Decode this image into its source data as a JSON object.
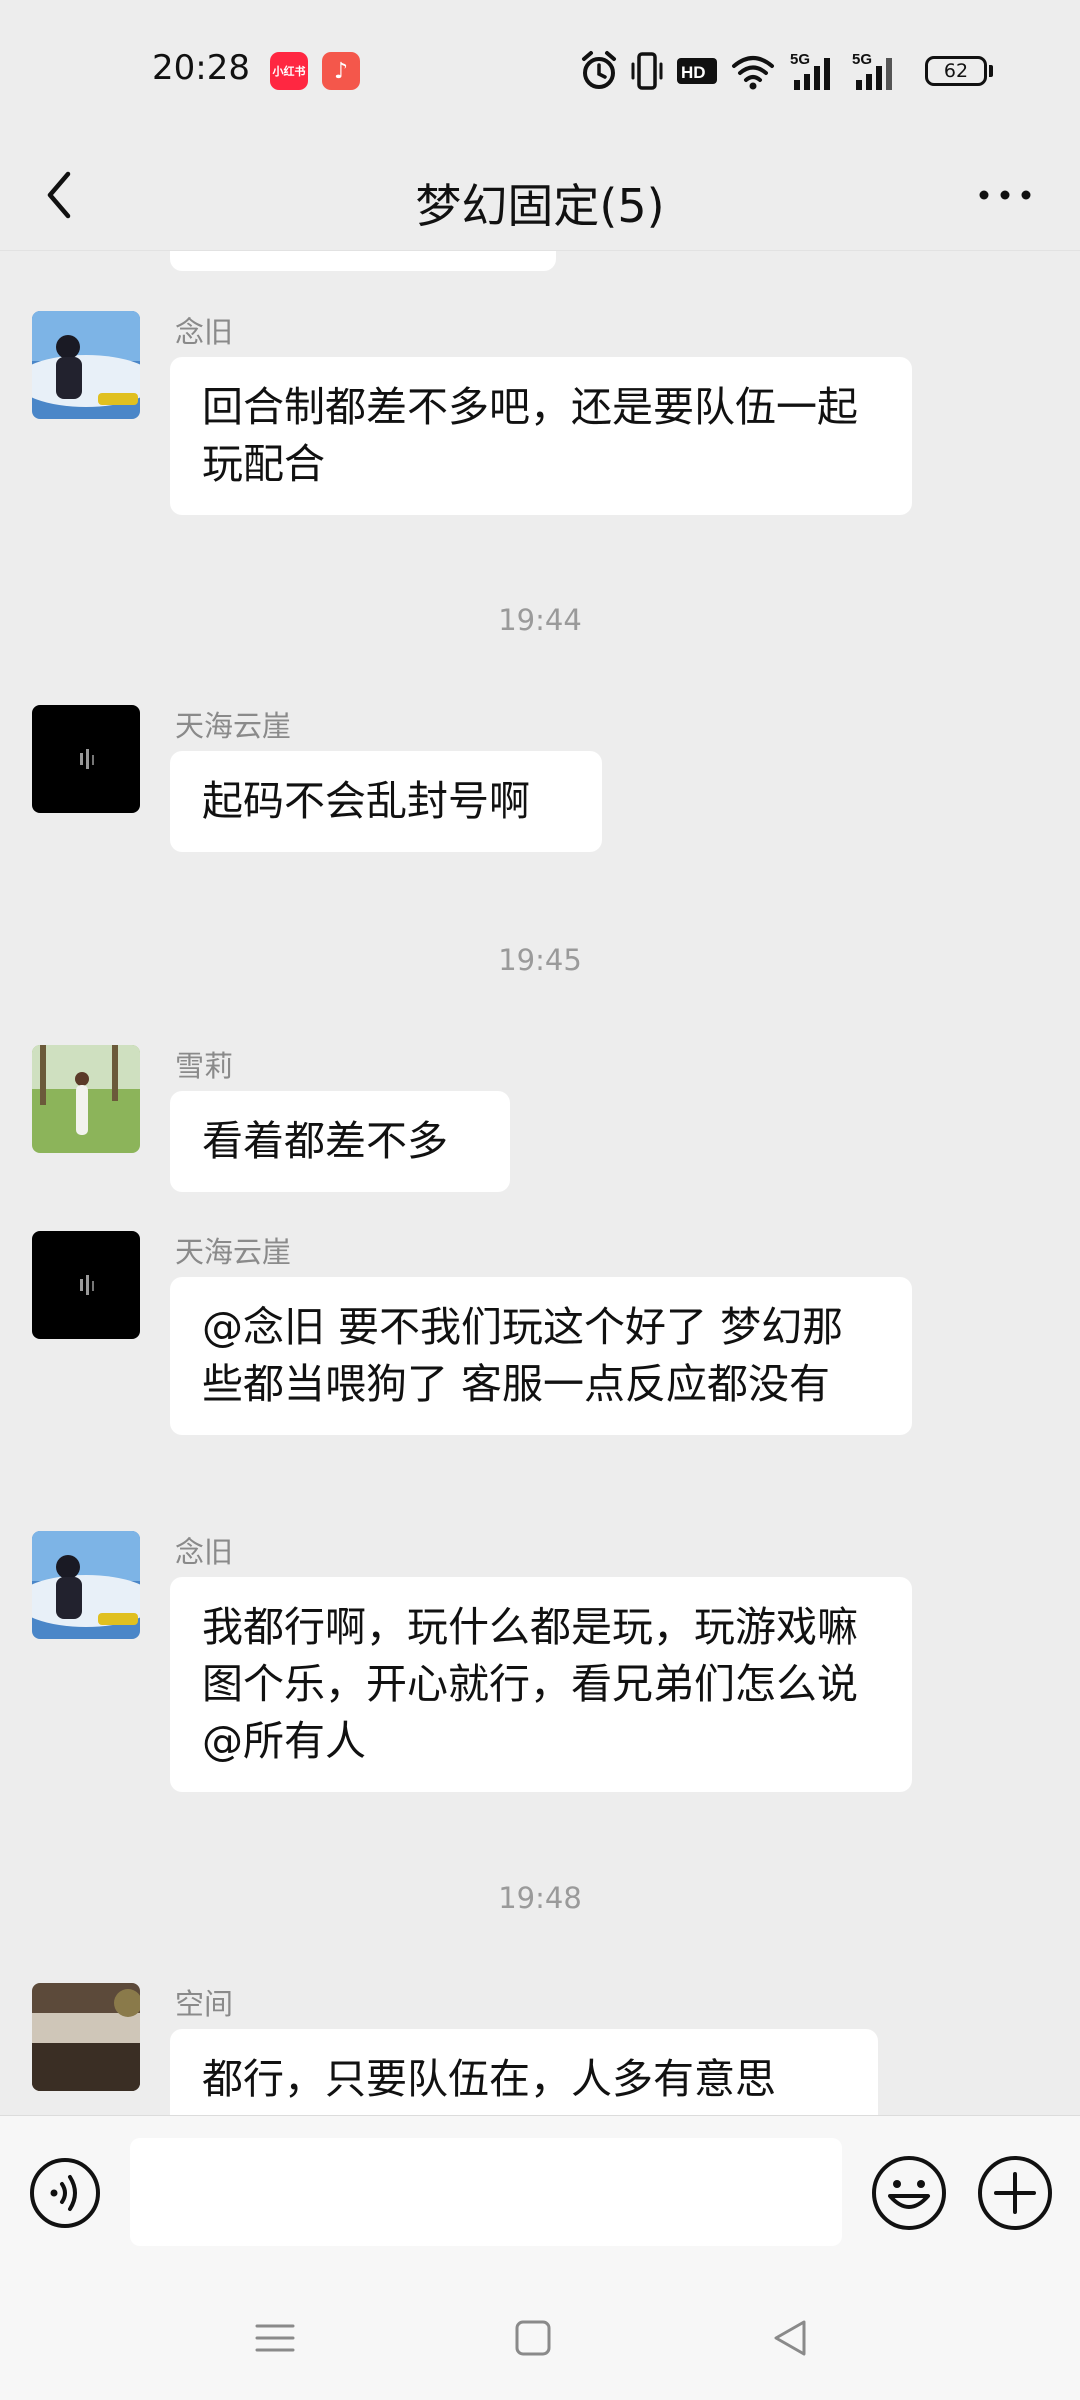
{
  "status_bar": {
    "time": "20:28",
    "app_badges": [
      {
        "name": "xiaohongshu-icon",
        "label": "小红书",
        "color": "#ff2741"
      },
      {
        "name": "music-app-icon",
        "label": "♪",
        "color": "#f4574b"
      }
    ],
    "icons": [
      "alarm-icon",
      "vibrate-icon",
      "hd-icon",
      "wifi-icon",
      "signal-5g-icon",
      "signal-5g-icon"
    ],
    "signal_label": "5G",
    "hd_label": "HD",
    "battery": "62"
  },
  "header": {
    "title": "梦幻固定(5)",
    "back_icon": "chevron-left-icon",
    "more_icon": "more-dots-icon"
  },
  "messages": [
    {
      "type": "text",
      "sender": "念旧",
      "text": "回合制都差不多吧，还是要队伍一起玩配合",
      "avatar": "nianjiu"
    },
    {
      "type": "time",
      "text": "19:44"
    },
    {
      "type": "text",
      "sender": "天海云崖",
      "text": "起码不会乱封号啊",
      "avatar": "tianhai"
    },
    {
      "type": "time",
      "text": "19:45"
    },
    {
      "type": "text",
      "sender": "雪莉",
      "text": "看着都差不多",
      "avatar": "xueli"
    },
    {
      "type": "text",
      "sender": "天海云崖",
      "text": "@念旧  要不我们玩这个好了 梦幻那些都当喂狗了 客服一点反应都没有",
      "avatar": "tianhai"
    },
    {
      "type": "text",
      "sender": "念旧",
      "text": "我都行啊，玩什么都是玩，玩游戏嘛图个乐，开心就行，看兄弟们怎么说@所有人",
      "avatar": "nianjiu"
    },
    {
      "type": "time",
      "text": "19:48"
    },
    {
      "type": "text",
      "sender": "空间",
      "text": "都行，只要队伍在，人多有意思",
      "avatar": "kongjian"
    }
  ],
  "input_bar": {
    "voice_icon": "voice-icon",
    "input_value": "",
    "emoji_icon": "emoji-icon",
    "plus_icon": "plus-icon"
  },
  "nav_bar": {
    "icons": [
      "menu-icon",
      "home-icon",
      "back-triangle-icon"
    ]
  },
  "colors": {
    "background": "#ededed",
    "bubble": "#ffffff",
    "sender_name": "#8a8a8a",
    "timestamp": "#9a9a9a"
  }
}
